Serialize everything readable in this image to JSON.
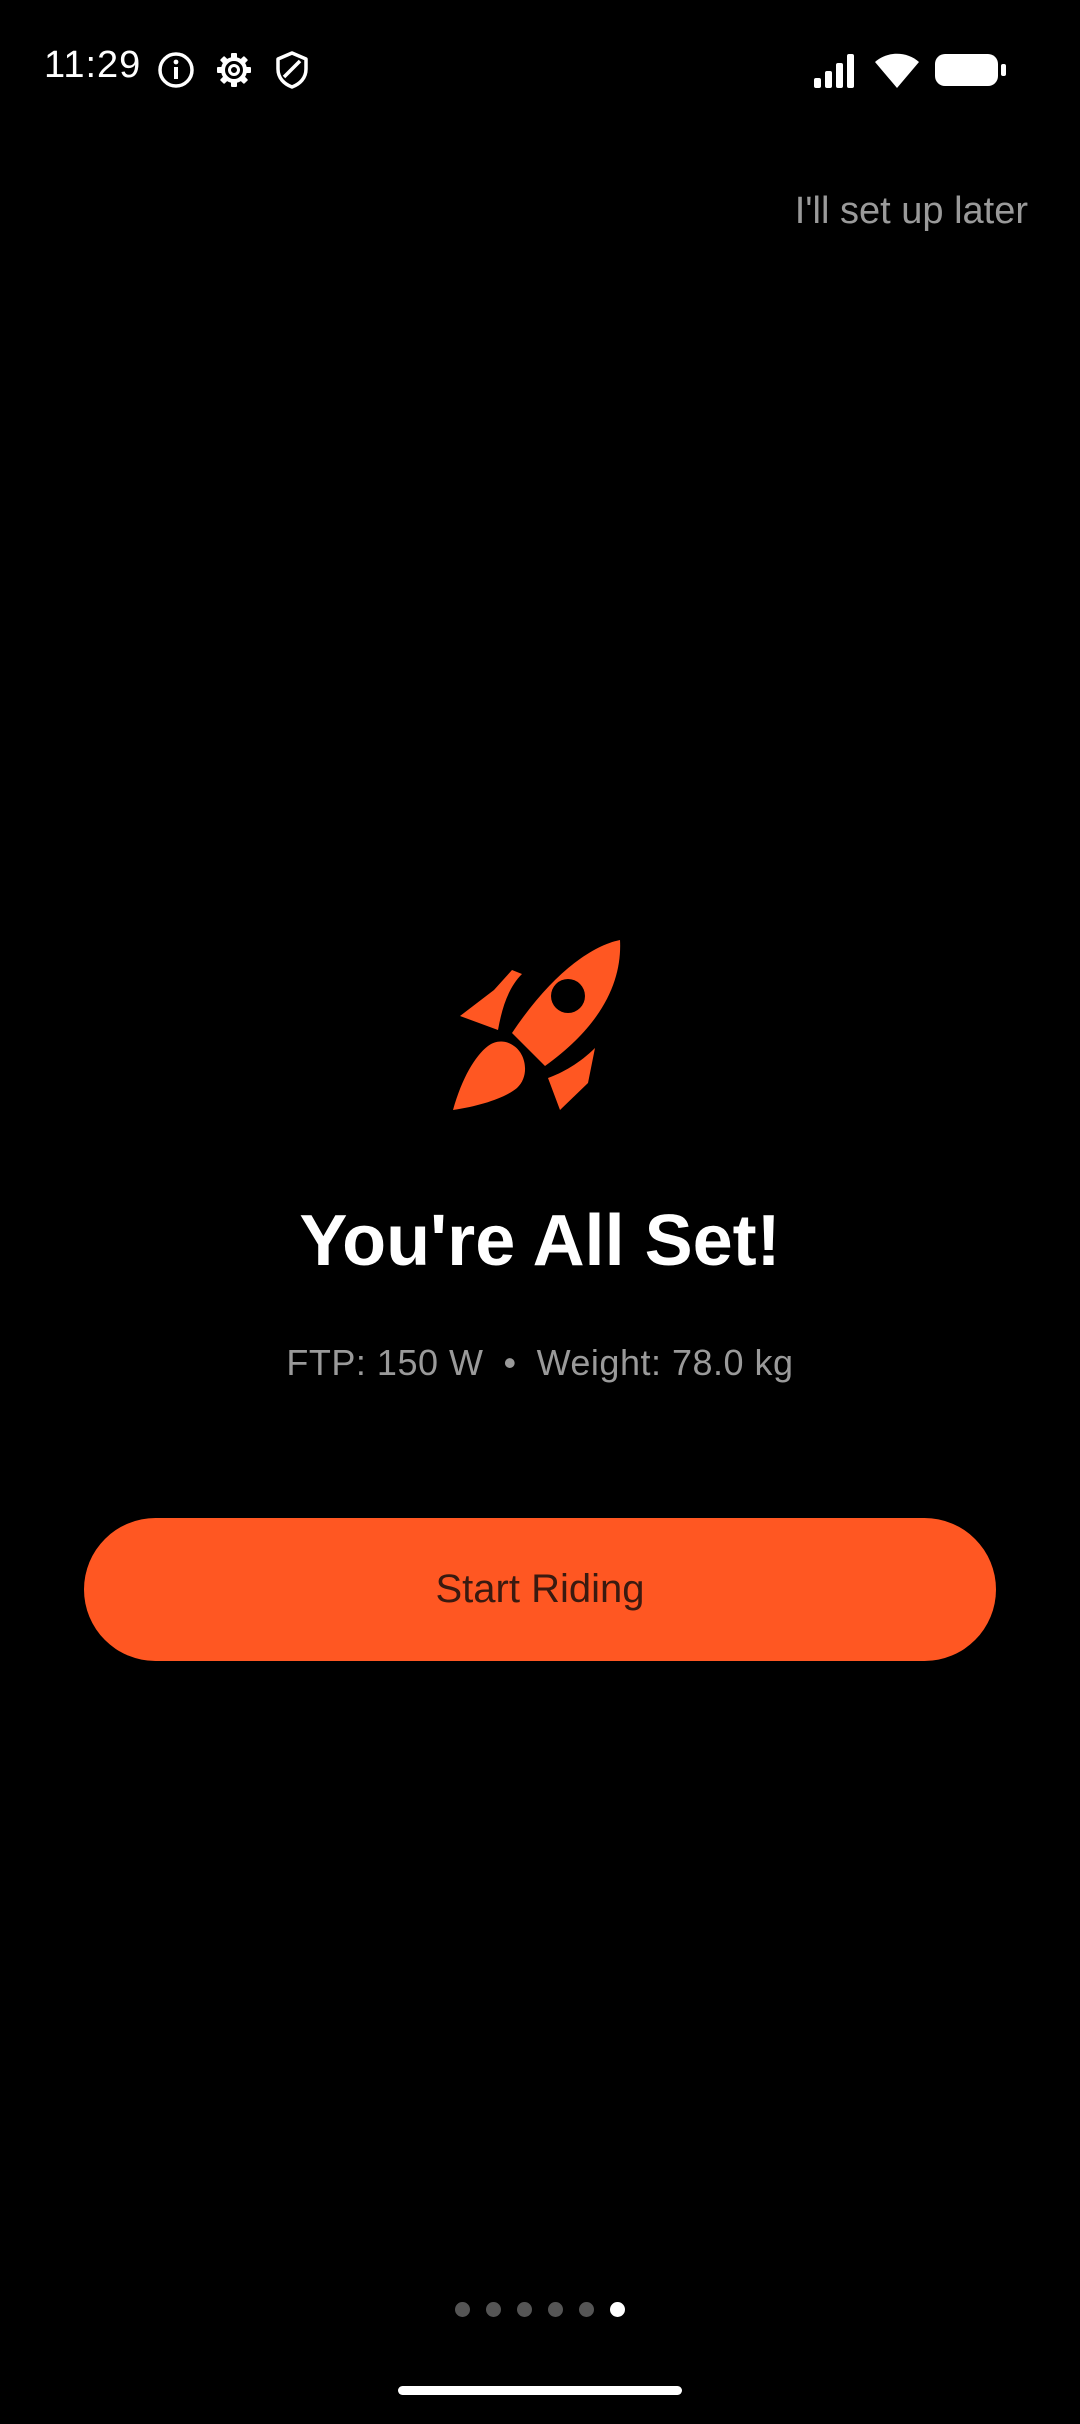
{
  "status_bar": {
    "time": "11:29",
    "left_icons": [
      "info-icon",
      "gear-icon",
      "shield-icon"
    ],
    "right_icons": [
      "signal-icon",
      "wifi-icon",
      "battery-icon"
    ]
  },
  "header": {
    "skip_label": "I'll set up later"
  },
  "main": {
    "icon": "rocket-icon",
    "title": "You're All Set!",
    "ftp": "FTP: 150 W",
    "separator": "•",
    "weight": "Weight: 78.0 kg",
    "button_label": "Start Riding"
  },
  "pager": {
    "total": 6,
    "active_index": 5
  },
  "colors": {
    "accent": "#FF5722",
    "background": "#000000",
    "muted_text": "#9A9A9A"
  }
}
